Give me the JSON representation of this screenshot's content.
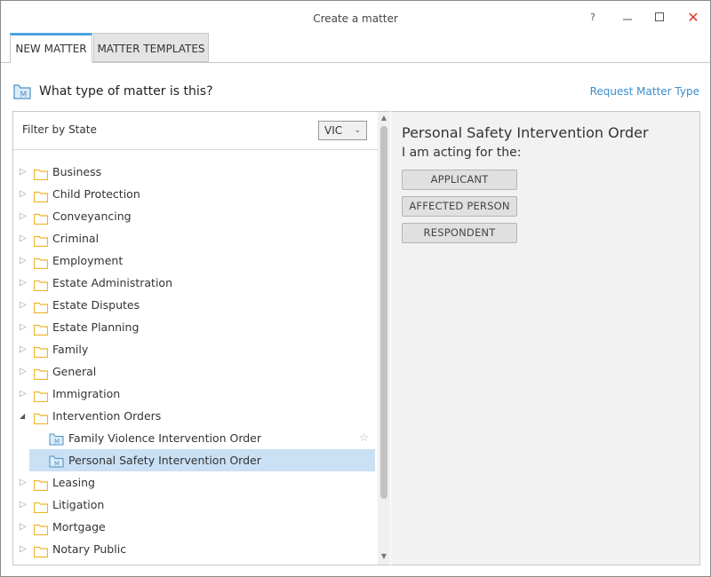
{
  "window": {
    "title": "Create a matter",
    "help_label": "?",
    "close_label": "✕"
  },
  "tabs": [
    {
      "label": "NEW MATTER",
      "active": true
    },
    {
      "label": "MATTER TEMPLATES",
      "active": false
    }
  ],
  "header": {
    "question": "What type of matter is this?",
    "request_link": "Request Matter Type"
  },
  "filter": {
    "label": "Filter by State",
    "selected_state": "VIC"
  },
  "tree": {
    "items": [
      {
        "label": "Business",
        "expanded": false
      },
      {
        "label": "Child Protection",
        "expanded": false
      },
      {
        "label": "Conveyancing",
        "expanded": false
      },
      {
        "label": "Criminal",
        "expanded": false
      },
      {
        "label": "Employment",
        "expanded": false
      },
      {
        "label": "Estate Administration",
        "expanded": false
      },
      {
        "label": "Estate Disputes",
        "expanded": false
      },
      {
        "label": "Estate Planning",
        "expanded": false
      },
      {
        "label": "Family",
        "expanded": false
      },
      {
        "label": "General",
        "expanded": false
      },
      {
        "label": "Immigration",
        "expanded": false
      },
      {
        "label": "Intervention Orders",
        "expanded": true
      },
      {
        "label": "Family Violence Intervention Order",
        "child": true
      },
      {
        "label": "Personal Safety Intervention Order",
        "child": true,
        "selected": true
      },
      {
        "label": "Leasing",
        "expanded": false
      },
      {
        "label": "Litigation",
        "expanded": false
      },
      {
        "label": "Mortgage",
        "expanded": false
      },
      {
        "label": "Notary Public",
        "expanded": false
      }
    ]
  },
  "detail": {
    "title": "Personal Safety Intervention Order",
    "subtitle": "I am acting for the:",
    "roles": [
      "APPLICANT",
      "AFFECTED PERSON",
      "RESPONDENT"
    ]
  },
  "colors": {
    "accent": "#4aa3df",
    "link": "#3a8fd0",
    "selection": "#c9e0f5",
    "folder": "#f0b429",
    "close": "#e03a2f"
  }
}
